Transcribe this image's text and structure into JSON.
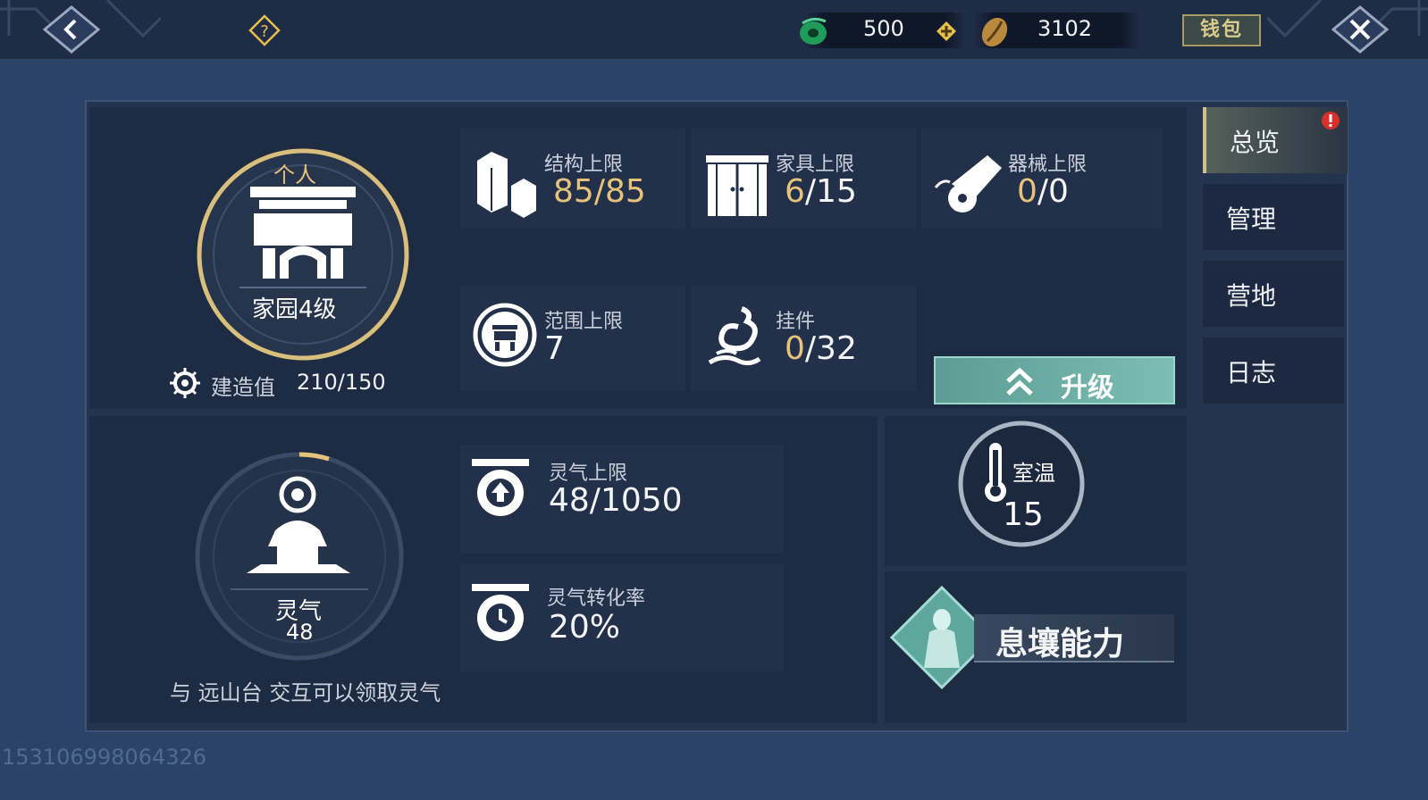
{
  "topbar": {
    "jade_amount": "500",
    "coin_amount": "3102",
    "wallet_label": "钱包"
  },
  "home": {
    "type_label": "个人",
    "level_label": "家园4级",
    "build_label": "建造值",
    "build_value": "210/150"
  },
  "stats": {
    "structure": {
      "label": "结构上限",
      "current": "85",
      "max": "/85"
    },
    "furniture": {
      "label": "家具上限",
      "current": "6",
      "max": "/15"
    },
    "machine": {
      "label": "器械上限",
      "current": "0",
      "max": "/0"
    },
    "range": {
      "label": "范围上限",
      "value": "7"
    },
    "pendant": {
      "label": "挂件",
      "current": "0",
      "max": "/32"
    }
  },
  "upgrade_label": "升级",
  "spirit": {
    "name": "灵气",
    "value": "48",
    "hint": "与 远山台 交互可以领取灵气",
    "limit_label": "灵气上限",
    "limit_value": "48/1050",
    "rate_label": "灵气转化率",
    "rate_value": "20%"
  },
  "temperature": {
    "label": "室温",
    "value": "15"
  },
  "ability_label": "息壤能力",
  "tabs": [
    {
      "label": "总览"
    },
    {
      "label": "管理"
    },
    {
      "label": "营地"
    },
    {
      "label": "日志"
    }
  ],
  "watermark": "153106998064326",
  "colors": {
    "gold": "#e7c27b",
    "accent_teal": "#6fb3a8",
    "alert_red": "#d9302c"
  }
}
